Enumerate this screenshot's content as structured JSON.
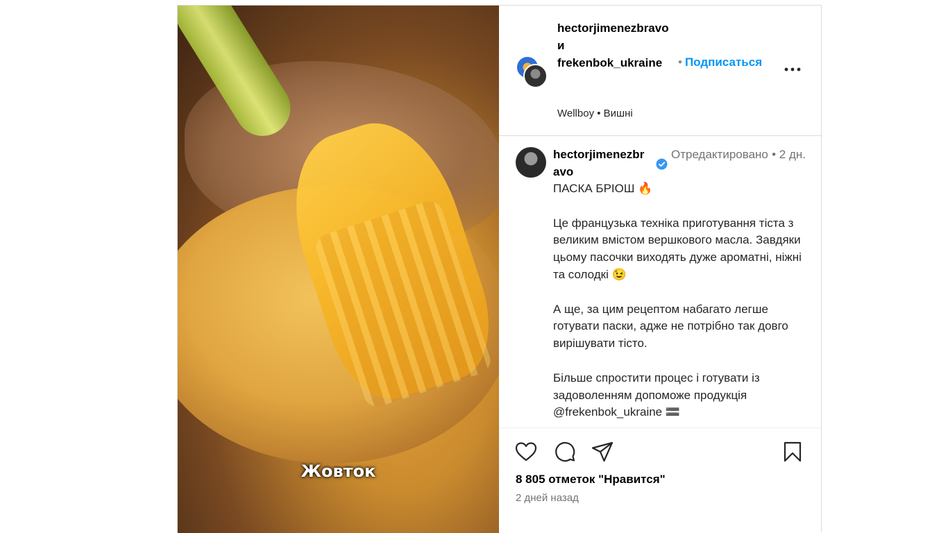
{
  "media": {
    "caption": "Жовток"
  },
  "header": {
    "owner_line1": "hectorjimenezbravo",
    "owner_and": "и",
    "owner_line2": "frekenbok_ukraine",
    "follow_dot": "•",
    "follow_label": "Подписаться",
    "music": "Wellboy • Вишні"
  },
  "comment": {
    "username": "hectorjimenezbravo",
    "edited": "Отредактировано",
    "time": "• 2 дн.",
    "text": "ПАСКА БРІОШ 🔥\n\nЦе французька техніка приготування тіста з великим вмістом вершкового масла. Завдяки цьому пасочки виходять дуже ароматні, ніжні та солодкі 😉\n\nА ще, за цим рецептом набагато легше готувати паски, адже не потрібно так довго вирішувати тісто.\n\nБільше спростити процес і готувати із задоволенням допоможе продукція @frekenbok_ukraine 🟰"
  },
  "actions": {
    "icons": [
      "heart-icon",
      "comment-icon",
      "share-icon",
      "bookmark-icon"
    ]
  },
  "stats": {
    "likes": "8 805 отметок \"Нравится\"",
    "date": "2 дней назад"
  },
  "colors": {
    "accent": "#0095f6",
    "verified": "#3897f0",
    "muted": "#737373",
    "border": "#dbdbdb"
  }
}
